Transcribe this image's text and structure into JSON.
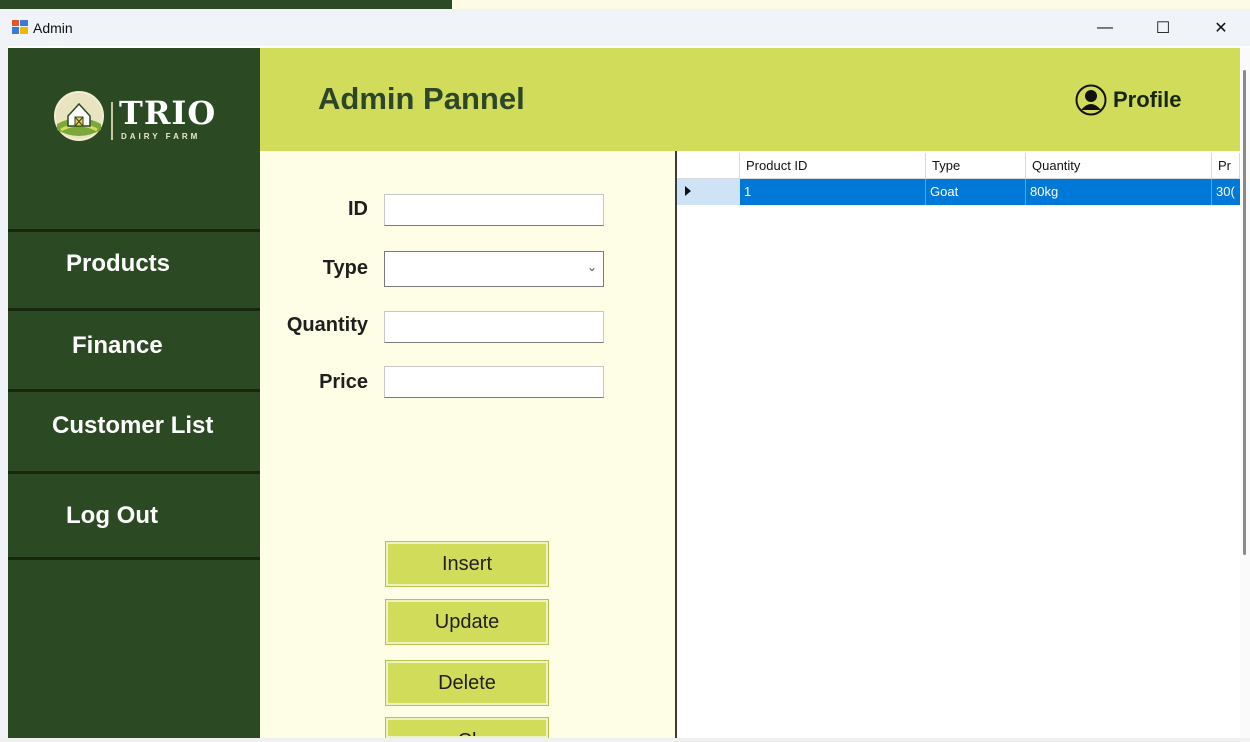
{
  "window": {
    "title": "Admin",
    "minimize": "—",
    "maximize": "☐",
    "close": "✕"
  },
  "brand": {
    "name": "TRIO",
    "tagline": "DAIRY FARM"
  },
  "sidebar": {
    "items": [
      {
        "label": "Products"
      },
      {
        "label": "Finance"
      },
      {
        "label": "Customer List"
      },
      {
        "label": "Log Out"
      }
    ]
  },
  "header": {
    "title": "Admin Pannel",
    "profile_label": "Profile"
  },
  "form": {
    "fields": [
      {
        "label": "ID",
        "value": ""
      },
      {
        "label": "Type",
        "value": ""
      },
      {
        "label": "Quantity",
        "value": ""
      },
      {
        "label": "Price",
        "value": ""
      }
    ],
    "buttons": [
      {
        "label": "Insert"
      },
      {
        "label": "Update"
      },
      {
        "label": "Delete"
      },
      {
        "label": "Cl"
      }
    ]
  },
  "grid": {
    "columns": [
      "Product ID",
      "Type",
      "Quantity",
      "Pr"
    ],
    "rows": [
      {
        "cells": [
          "1",
          "Goat",
          "80kg",
          "30("
        ],
        "selected": true
      }
    ]
  },
  "colors": {
    "sidebar": "#2b4a24",
    "header": "#d2dc5b",
    "form_bg": "#fefee6",
    "selection": "#0078d7"
  }
}
